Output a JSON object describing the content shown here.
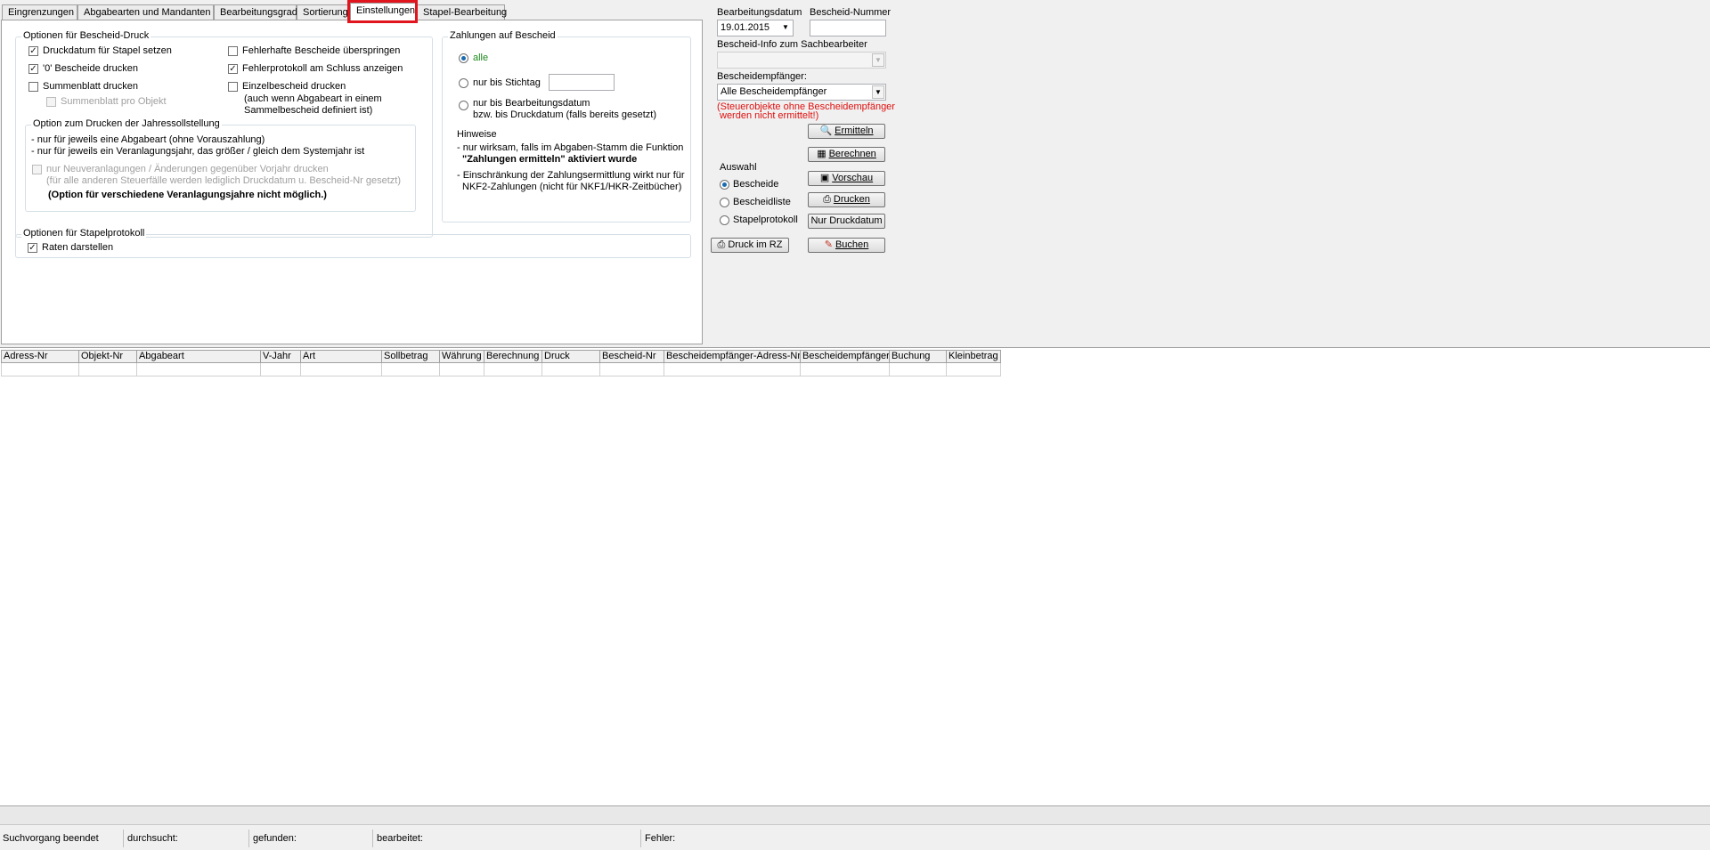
{
  "tabs": [
    {
      "label": "Eingrenzungen"
    },
    {
      "label": "Abgabearten und Mandanten"
    },
    {
      "label": "Bearbeitungsgrad"
    },
    {
      "label": "Sortierung"
    },
    {
      "label": "Einstellungen",
      "active": true
    },
    {
      "label": "Stapel-Bearbeitung"
    }
  ],
  "bescheid_druck": {
    "title": "Optionen für Bescheid-Druck",
    "druckdatum": {
      "label": "Druckdatum für Stapel setzen",
      "checked": true
    },
    "null_bescheide": {
      "label": "'0' Bescheide drucken",
      "checked": true
    },
    "summenblatt": {
      "label": "Summenblatt drucken",
      "checked": false
    },
    "summenblatt_objekt": {
      "label": "Summenblatt pro Objekt",
      "checked": false
    },
    "fehlerhafte": {
      "label": "Fehlerhafte Bescheide überspringen",
      "checked": false
    },
    "fehlerprotokoll": {
      "label": "Fehlerprotokoll am Schluss anzeigen",
      "checked": true
    },
    "einzelbescheid": {
      "label": "Einzelbescheid drucken",
      "checked": false
    },
    "einzelbescheid_note1": "(auch wenn Abgabeart in einem",
    "einzelbescheid_note2": "Sammelbescheid definiert ist)"
  },
  "jahressoll": {
    "title": "Option zum Drucken der Jahressollstellung",
    "line1": "- nur für jeweils eine Abgabeart (ohne Vorauszahlung)",
    "line2": "- nur für jeweils ein Veranlagungsjahr, das größer / gleich dem Systemjahr ist",
    "neuveranlagung": {
      "label": "nur Neuveranlagungen / Änderungen gegenüber Vorjahr drucken",
      "checked": false
    },
    "note": "(für alle anderen Steuerfälle werden lediglich Druckdatum u. Bescheid-Nr gesetzt)",
    "bold_note": "(Option für verschiedene Veranlagungsjahre nicht möglich.)"
  },
  "zahlungen": {
    "title": "Zahlungen auf Bescheid",
    "alle": "alle",
    "stichtag": "nur bis Stichtag",
    "stichtag_value": "",
    "bearbeitungsdatum1": "nur bis Bearbeitungsdatum",
    "bearbeitungsdatum2": "bzw. bis Druckdatum (falls bereits gesetzt)",
    "hinweise": "Hinweise",
    "h1": "- nur wirksam, falls im Abgaben-Stamm die Funktion",
    "h1_bold": "\"Zahlungen ermitteln\" aktiviert wurde",
    "h2": "- Einschränkung der Zahlungsermittlung wirkt nur für",
    "h3": "NKF2-Zahlungen (nicht für NKF1/HKR-Zeitbücher)"
  },
  "stapelprotokoll": {
    "title": "Optionen für Stapelprotokoll",
    "raten": {
      "label": "Raten darstellen",
      "checked": true
    }
  },
  "right": {
    "bearbeitungsdatum_label": "Bearbeitungsdatum",
    "bearbeitungsdatum_value": "19.01.2015",
    "bescheid_nummer_label": "Bescheid-Nummer",
    "bescheid_nummer_value": "",
    "info_label": "Bescheid-Info zum Sachbearbeiter",
    "info_value": "",
    "empfaenger_label": "Bescheidempfänger:",
    "empfaenger_value": "Alle Bescheidempfänger",
    "warning1": "(Steuerobjekte ohne Bescheidempfänger",
    "warning2": "werden nicht ermittelt!)",
    "btn_ermitteln": "Ermitteln",
    "btn_berechnen": "Berechnen",
    "btn_vorschau": "Vorschau",
    "btn_drucken": "Drucken",
    "btn_nur_druckdatum": "Nur Druckdatum",
    "btn_druck_rz": "Druck im RZ",
    "btn_buchen": "Buchen",
    "auswahl_title": "Auswahl",
    "auswahl": [
      "Bescheide",
      "Bescheidliste",
      "Stapelprotokoll"
    ],
    "auswahl_selected": "Bescheide"
  },
  "grid": {
    "columns": [
      "Adress-Nr",
      "Objekt-Nr",
      "Abgabeart",
      "V-Jahr",
      "Art",
      "Sollbetrag",
      "Währung",
      "Berechnung",
      "Druck",
      "Bescheid-Nr",
      "Bescheidempfänger-Adress-Nr.",
      "Bescheidempfänger",
      "Buchung",
      "Kleinbetrag"
    ],
    "rows": []
  },
  "status": {
    "state": "Suchvorgang beendet",
    "durchsucht": "durchsucht:",
    "gefunden": "gefunden:",
    "bearbeitet": "bearbeitet:",
    "fehler": "Fehler:"
  },
  "colors": {
    "highlight": "#e0151e",
    "warning": "#e01010",
    "alle": "#1a8a1a"
  }
}
